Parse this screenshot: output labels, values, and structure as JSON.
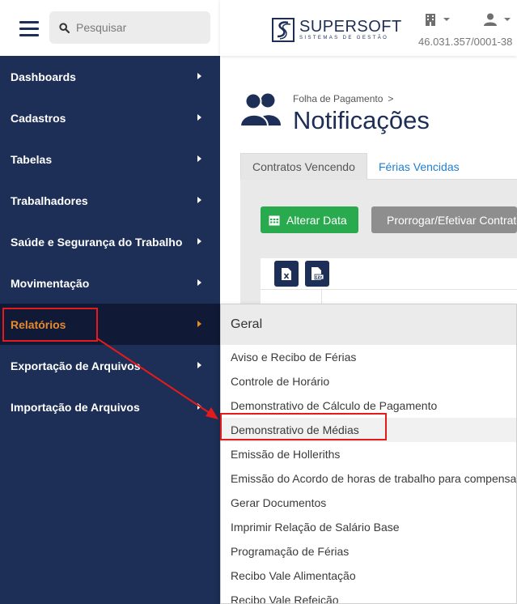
{
  "sidebar": {
    "search_placeholder": "Pesquisar",
    "items": [
      {
        "label": "Dashboards"
      },
      {
        "label": "Cadastros"
      },
      {
        "label": "Tabelas"
      },
      {
        "label": "Trabalhadores"
      },
      {
        "label": "Saúde e Segurança do Trabalho"
      },
      {
        "label": "Movimentação"
      },
      {
        "label": "Relatórios",
        "active": true
      },
      {
        "label": "Exportação de Arquivos"
      },
      {
        "label": "Importação de Arquivos"
      }
    ]
  },
  "header": {
    "logo_name": "SUPERSOFT",
    "logo_sub": "SISTEMAS DE GESTÃO",
    "cnpj": "46.031.357/0001-38"
  },
  "page": {
    "breadcrumb": "Folha de Pagamento",
    "breadcrumb_sep": ">",
    "title": "Notificações",
    "tabs": [
      {
        "label": "Contratos Vencendo"
      },
      {
        "label": "Férias Vencidas"
      }
    ],
    "buttons": {
      "alter_date": "Alterar Data",
      "extend": "Prorrogar/Efetivar Contrato"
    }
  },
  "dropdown": {
    "header": "Geral",
    "items": [
      "Aviso e Recibo de Férias",
      "Controle de Horário",
      "Demonstrativo de Cálculo de Pagamento",
      "Demonstrativo de Médias",
      "Emissão de Holleriths",
      "Emissão do Acordo de horas de trabalho para compensação",
      "Gerar Documentos",
      "Imprimir Relação de Salário Base",
      "Programação de Férias",
      "Recibo Vale Alimentação",
      "Recibo Vale Refeição"
    ],
    "highlighted_item": "Demonstrativo de Médias"
  },
  "colors": {
    "sidebar_bg": "#1d2f56",
    "active_item": "#e8892b",
    "green_button": "#2aaa4f",
    "gray_button": "#8e8e8e",
    "annotation": "#e31b1b",
    "tab_link": "#1e7fd0"
  },
  "icons": {
    "menu": "hamburger-icon",
    "search": "search-icon",
    "company": "building-icon",
    "user": "user-icon",
    "page": "users-icon",
    "calendar": "calendar-icon",
    "check": "check-icon",
    "excel": "excel-file-icon",
    "csv": "csv-file-icon"
  }
}
